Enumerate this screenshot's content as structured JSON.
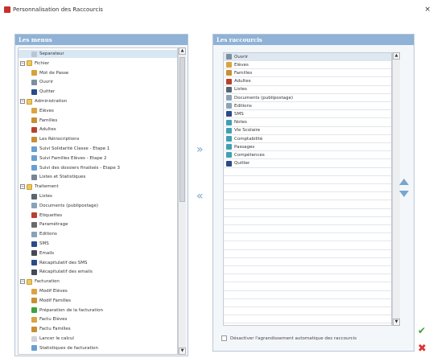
{
  "window": {
    "title": "Personnalisation des Raccourcis",
    "close": "×"
  },
  "left": {
    "heading": "Les menus",
    "items": [
      {
        "label": "Separateur",
        "level": 1,
        "color": "#b9c6d3",
        "selected": true
      },
      {
        "label": "Fichier",
        "level": 0,
        "folder": true
      },
      {
        "label": "Mot de Passe",
        "level": 1,
        "color": "#d8a03a"
      },
      {
        "label": "Ouvrir",
        "level": 1,
        "color": "#7d8ea0"
      },
      {
        "label": "Quitter",
        "level": 1,
        "color": "#2a4a8a"
      },
      {
        "label": "Administration",
        "level": 0,
        "folder": true
      },
      {
        "label": "Elèves",
        "level": 1,
        "color": "#d9a441"
      },
      {
        "label": "Familles",
        "level": 1,
        "color": "#c98f35"
      },
      {
        "label": "Adultes",
        "level": 1,
        "color": "#b7412e"
      },
      {
        "label": "Les Réinscriptions",
        "level": 1,
        "color": "#c98f35"
      },
      {
        "label": "Suivi Solidarité Classe - Etape 1",
        "level": 1,
        "color": "#6a9fd2"
      },
      {
        "label": "Suivi Familles Elèves - Etape 2",
        "level": 1,
        "color": "#6a9fd2"
      },
      {
        "label": "Suivi des dossiers finalisés - Etape 3",
        "level": 1,
        "color": "#6a9fd2"
      },
      {
        "label": "Listes et Statistiques",
        "level": 1,
        "color": "#7a8592"
      },
      {
        "label": "Traitement",
        "level": 0,
        "folder": true
      },
      {
        "label": "Listes",
        "level": 1,
        "color": "#5a6572"
      },
      {
        "label": "Documents (publipostage)",
        "level": 1,
        "color": "#8aa2ba"
      },
      {
        "label": "Etiquettes",
        "level": 1,
        "color": "#b7412e"
      },
      {
        "label": "Paramétrage",
        "level": 1,
        "color": "#6a6a6a"
      },
      {
        "label": "Editions",
        "level": 1,
        "color": "#8aa2ba"
      },
      {
        "label": "SMS",
        "level": 1,
        "color": "#2a4a8a"
      },
      {
        "label": "Emails",
        "level": 1,
        "color": "#444a55"
      },
      {
        "label": "Récapitulatif des SMS",
        "level": 1,
        "color": "#2a4a8a"
      },
      {
        "label": "Récapitulatif des emails",
        "level": 1,
        "color": "#444a55"
      },
      {
        "label": "Facturation",
        "level": 0,
        "folder": true
      },
      {
        "label": "Modif Elèves",
        "level": 1,
        "color": "#d9a441"
      },
      {
        "label": "Modif Familles",
        "level": 1,
        "color": "#c98f35"
      },
      {
        "label": "Préparation de la facturation",
        "level": 1,
        "color": "#3aa53a"
      },
      {
        "label": "Factu Elèves",
        "level": 1,
        "color": "#d9a441"
      },
      {
        "label": "Factu Familles",
        "level": 1,
        "color": "#c98f35"
      },
      {
        "label": "Lancer le calcul",
        "level": 1,
        "color": "#d0d4d8"
      },
      {
        "label": "Statistiques de facturation",
        "level": 1,
        "color": "#6a9fd2"
      }
    ]
  },
  "right": {
    "heading": "Les raccourcis",
    "items": [
      {
        "label": "Ouvrir",
        "color": "#7d8ea0",
        "selected": true
      },
      {
        "label": "Elèves",
        "color": "#d9a441"
      },
      {
        "label": "Familles",
        "color": "#c98f35"
      },
      {
        "label": "Adultes",
        "color": "#b7412e"
      },
      {
        "label": "Listes",
        "color": "#5a6572"
      },
      {
        "label": "Documents (publipostage)",
        "color": "#8aa2ba"
      },
      {
        "label": "Editions",
        "color": "#8aa2ba"
      },
      {
        "label": "SMS",
        "color": "#2a4a8a"
      },
      {
        "label": "Notes",
        "color": "#3fa0b5"
      },
      {
        "label": "Vie Scolaire",
        "color": "#3fa0b5"
      },
      {
        "label": "Comptabilité",
        "color": "#3fa0b5"
      },
      {
        "label": "Passages",
        "color": "#3fa0b5"
      },
      {
        "label": "Compétences",
        "color": "#3fa0b5"
      },
      {
        "label": "Quitter",
        "color": "#2a4a8a"
      }
    ],
    "empty_rows": 19
  },
  "controls": {
    "add": "»",
    "remove": "«",
    "auto_grow_label": "Désactiver l'agrandissement automatique des raccourcis",
    "ok": "✔",
    "cancel": "✖"
  },
  "colors": {
    "accent": "#8fb2d6",
    "arrow": "#7aa6cc"
  }
}
